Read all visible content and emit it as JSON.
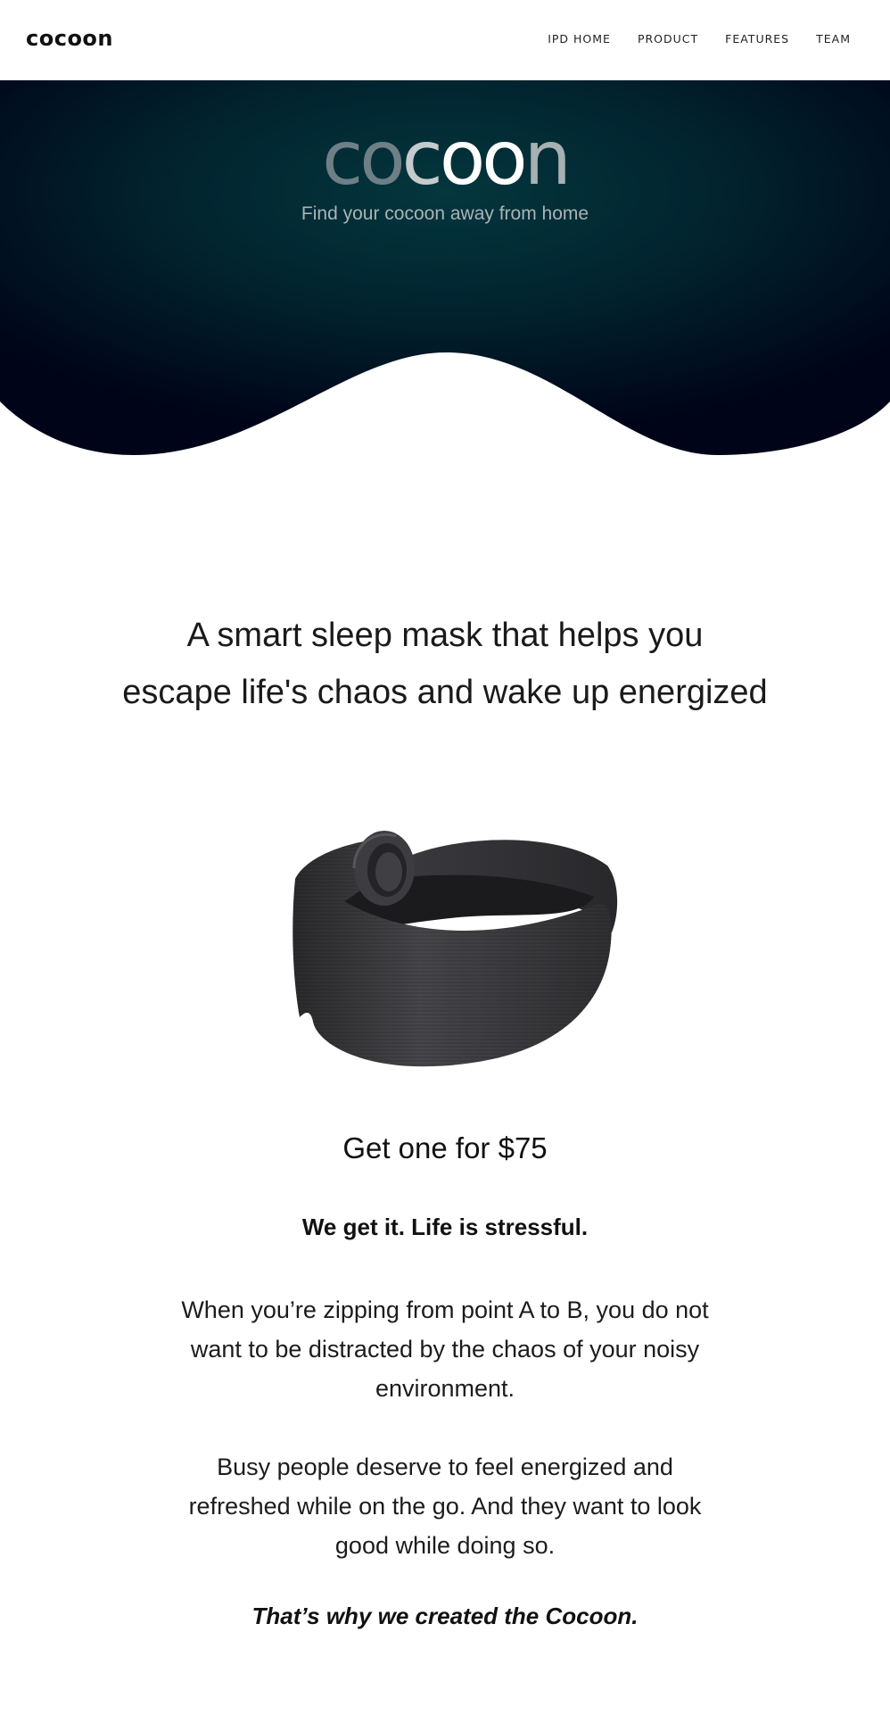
{
  "nav": {
    "brand": "cocoon",
    "links": [
      "IPD HOME",
      "PRODUCT",
      "FEATURES",
      "TEAM"
    ]
  },
  "hero": {
    "logo_parts": [
      "co",
      "c",
      "oo",
      "n"
    ],
    "tagline": "Find your cocoon away from home",
    "colors": {
      "dark": "#000418",
      "teal": "#04363d"
    }
  },
  "main": {
    "headline_line1": "A smart sleep mask that helps you",
    "headline_line2": "escape life's chaos and wake up energized",
    "product_image": "sleep-mask-image",
    "price_cta": "Get one for $75",
    "lead": "We get it. Life is stressful.",
    "paragraph1": "When you’re zipping from point A to B, you do not want to be distracted by the chaos of your noisy environment.",
    "paragraph2": "Busy people deserve to feel energized and refreshed while on the go. And they want to look good while doing so.",
    "closing": "That’s why we created the Cocoon."
  }
}
